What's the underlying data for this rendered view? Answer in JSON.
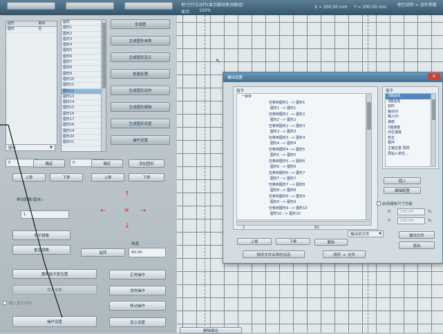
{
  "top_bar": {
    "status_line": "把'已行立动作(显示删动变动路径)",
    "label_left": "显示:",
    "zoom_value": "100%",
    "coord_x": "X = 200.00 mm",
    "coord_y": "Y = 200.00 mm",
    "right_status": "把已动作 > 动作参数"
  },
  "left_panel": {
    "list1_headers": [
      "图形",
      "输出"
    ],
    "list1_rows": [
      [
        "图形",
        "否"
      ]
    ],
    "list2_items": [
      "图形",
      "图形1",
      "图形2",
      "图形3",
      "图形4",
      "图形5",
      "图形6",
      "图形7",
      "图形8",
      "图形9",
      "图形10",
      "图形11",
      "图形12",
      "图形13",
      "图形14",
      "图形15",
      "图形16",
      "图形17",
      "图形18",
      "图形19",
      "图形20",
      "图形21"
    ],
    "list2_selected_index": 12,
    "side_buttons": [
      "全选图",
      "生成图形参数",
      "生成图形显示",
      "批量处理",
      "生成图形动作",
      "生成图形编辑",
      "生成图形设置",
      "操作设置"
    ],
    "combo_value": "图形",
    "row1": {
      "value_left": "0",
      "confirm1": "确定",
      "value_mid": "0",
      "confirm2": "确定",
      "add_button": "添加图形"
    },
    "row2": [
      "上移",
      "下移",
      "上移",
      "下移"
    ],
    "move_distance_label": "移动距离(毫米):",
    "move_distance_value": "1",
    "btn_horizontal": "水平镜像",
    "btn_vertical": "垂直镜像",
    "rotate_label": "角度",
    "rotate_button": "旋转",
    "rotate_value": "90.00",
    "btn_home": "重新指令复位置",
    "btn_normal": "正常操作",
    "btn_disabled": "保存参数",
    "btn_operation": "加快操作",
    "checkbox_label": "输入显示动作",
    "btn_move_op": "移动操作",
    "btn_operate_settings": "操作设置",
    "btn_display_settings": "显示设置",
    "btn_delete_bottom": "删除路径"
  },
  "dialog": {
    "title": "输出设置",
    "group_label": "指令",
    "tree_root": "一级单",
    "left_items": [
      "空移到图形1 --> 图形1",
      "图形1 --> 图形1",
      "空移到图形1 --> 图形2",
      "图形2 --> 图形2",
      "空移到图形2 --> 图形3",
      "图形3 --> 图形3",
      "空移到图形3 --> 图形4",
      "图形4 --> 图形4",
      "空移到图形4 --> 图形5",
      "图形5 --> 图形5",
      "空移到图形5 --> 图形6",
      "图形6 --> 图形6",
      "空移到图形6 --> 图形7",
      "图形7 --> 图形7",
      "空移到图形7 --> 图形8",
      "图形8 --> 图形8",
      "空移到图形8 --> 图形9",
      "图形9 --> 图形9",
      "空移到图形9 --> 图形10",
      "图形10 --> 图形10"
    ],
    "right_group_label": "指令",
    "right_items": [
      "2轴运动",
      "3轴运动",
      "延时",
      "输出IO",
      "输入IO",
      "速度",
      "2轴速度",
      "点位速度",
      "校正",
      "循环",
      "主轴位置 再现",
      "再钻入单位..."
    ],
    "right_selected_index": 0,
    "page_left": "1",
    "page_mid": "82",
    "combo_file": "输出到文件",
    "btn_insert": "插入",
    "btn_edit": "编辑配置",
    "chk_size_label": "启用缩放尺寸功能",
    "x_label": "X:",
    "x_value": "100.00",
    "x_unit": "%",
    "y_label": "Y:",
    "y_value": "100.00",
    "y_unit": "%",
    "btn_output_file": "输出文件",
    "btn_exit": "退出",
    "btn_up": "上移",
    "btn_down": "下移",
    "btn_delete": "删除",
    "btn_save_paths": "排序文件名称的另存",
    "btn_sort": "排序 -> 文件"
  }
}
